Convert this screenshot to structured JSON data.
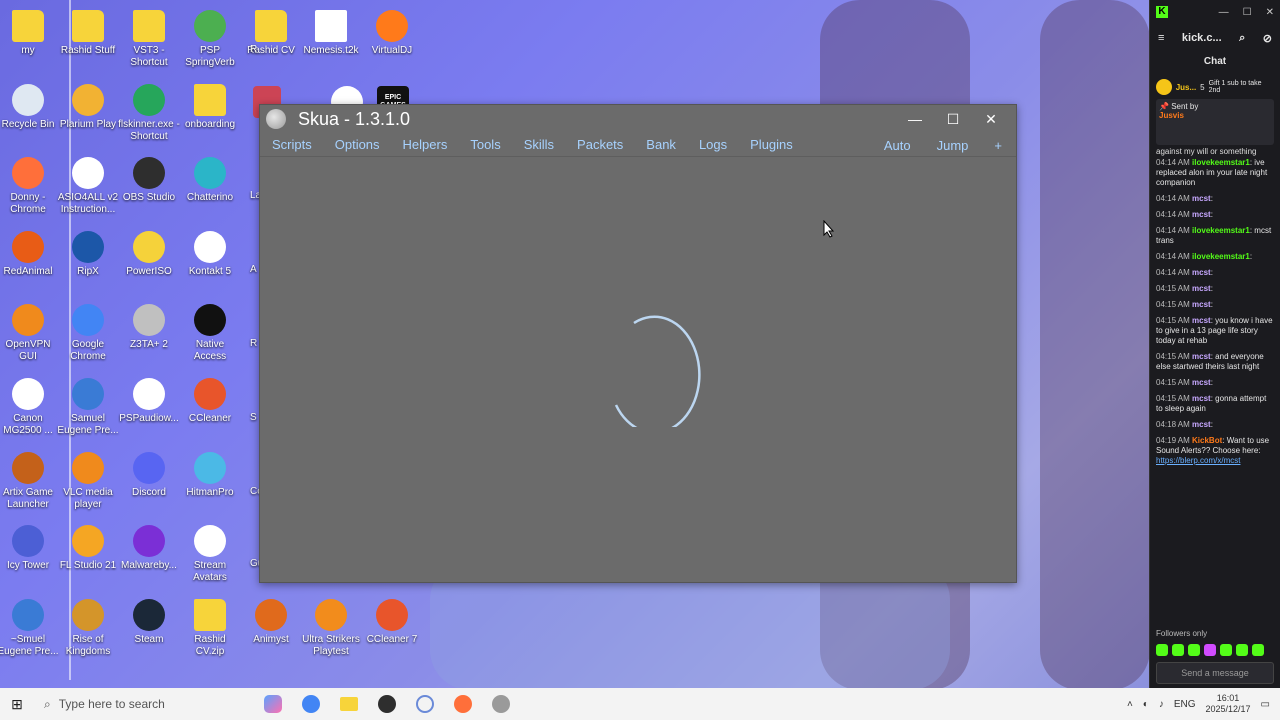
{
  "desktop": {
    "icons": [
      {
        "label": "my",
        "kind": "folder",
        "color": "#f7d43a"
      },
      {
        "label": "Rashid Stuff",
        "kind": "folder",
        "color": "#f7d43a"
      },
      {
        "label": "VST3 - Shortcut",
        "kind": "folder",
        "color": "#f7d43a"
      },
      {
        "label": "PSP SpringVerb",
        "kind": "app",
        "color": "#4caf50"
      },
      {
        "label": "Rashid CV",
        "kind": "folder",
        "color": "#f7d43a"
      },
      {
        "label": "Nemesis.t2k",
        "kind": "file",
        "color": "#ffffff"
      },
      {
        "label": "VirtualDJ",
        "kind": "app",
        "color": "#ff7a1a"
      },
      {
        "label": "Recycle Bin",
        "kind": "app",
        "color": "#dfe8f2"
      },
      {
        "label": "Plarium Play",
        "kind": "app",
        "color": "#f2b233"
      },
      {
        "label": "flskinner.exe - Shortcut",
        "kind": "app",
        "color": "#26a65b"
      },
      {
        "label": "onboarding",
        "kind": "folder",
        "color": "#f7d43a"
      },
      {
        "label": "Donny - Chrome",
        "kind": "app",
        "color": "#ff6f3a"
      },
      {
        "label": "ASIO4ALL v2 Instruction...",
        "kind": "app",
        "color": "#ffffff"
      },
      {
        "label": "OBS Studio",
        "kind": "app",
        "color": "#2e2e2e"
      },
      {
        "label": "Chatterino",
        "kind": "app",
        "color": "#2bb5c8"
      },
      {
        "label": "RedAnimal",
        "kind": "app",
        "color": "#e85c16"
      },
      {
        "label": "RipX",
        "kind": "app",
        "color": "#1c57a8"
      },
      {
        "label": "PowerISO",
        "kind": "app",
        "color": "#f5d23a"
      },
      {
        "label": "Kontakt 5",
        "kind": "app",
        "color": "#ffffff"
      },
      {
        "label": "OpenVPN GUI",
        "kind": "app",
        "color": "#f08a1c"
      },
      {
        "label": "Google Chrome",
        "kind": "app",
        "color": "#4285f4"
      },
      {
        "label": "Z3TA+ 2",
        "kind": "app",
        "color": "#c0c0c0"
      },
      {
        "label": "Native Access",
        "kind": "app",
        "color": "#111111"
      },
      {
        "label": "Canon MG2500 ...",
        "kind": "app",
        "color": "#ffffff"
      },
      {
        "label": "Samuel Eugene Pre...",
        "kind": "app",
        "color": "#3a7bd5"
      },
      {
        "label": "PSPaudiow...",
        "kind": "app",
        "color": "#ffffff"
      },
      {
        "label": "CCleaner",
        "kind": "app",
        "color": "#e8552b"
      },
      {
        "label": "Artix Game Launcher",
        "kind": "app",
        "color": "#c4611a"
      },
      {
        "label": "VLC media player",
        "kind": "app",
        "color": "#f08a1c"
      },
      {
        "label": "Discord",
        "kind": "app",
        "color": "#5865f2"
      },
      {
        "label": "HitmanPro",
        "kind": "app",
        "color": "#4bb9e6"
      },
      {
        "label": "Icy Tower",
        "kind": "app",
        "color": "#4c5fd5"
      },
      {
        "label": "FL Studio 21",
        "kind": "app",
        "color": "#f5a623"
      },
      {
        "label": "Malwareby...",
        "kind": "app",
        "color": "#7b2fd6"
      },
      {
        "label": "Stream Avatars",
        "kind": "app",
        "color": "#ffffff"
      },
      {
        "label": "~Smuel Eugene Pre...",
        "kind": "app",
        "color": "#3a7bd5"
      },
      {
        "label": "Rise of Kingdoms",
        "kind": "app",
        "color": "#d4952a"
      },
      {
        "label": "Steam",
        "kind": "app",
        "color": "#1b2838"
      },
      {
        "label": "Rashid CV.zip",
        "kind": "folder",
        "color": "#f7d43a"
      },
      {
        "label": "Animyst",
        "kind": "app",
        "color": "#e06a1c"
      },
      {
        "label": "Ultra Strikers Playtest",
        "kind": "app",
        "color": "#f28c1c"
      },
      {
        "label": "CCleaner 7",
        "kind": "app",
        "color": "#e8552b"
      }
    ],
    "partial_icon_labels": [
      "R",
      "La",
      "A",
      "R",
      "S",
      "Co",
      "Gu"
    ],
    "behind_window_icon_label": "EPIC GAMES"
  },
  "skua": {
    "title": "Skua - 1.3.1.0",
    "menu": [
      "Scripts",
      "Options",
      "Helpers",
      "Tools",
      "Skills",
      "Packets",
      "Bank",
      "Logs",
      "Plugins"
    ],
    "menu_right": [
      "Auto",
      "Jump",
      "+"
    ],
    "window_controls": {
      "minimize": "—",
      "maximize": "☐",
      "close": "✕"
    },
    "loading": true
  },
  "chat": {
    "url": "kick.c...",
    "heading": "Chat",
    "gift": {
      "user": "Jus...",
      "count": "5",
      "text": "Gift 1 sub to take 2nd"
    },
    "pinned_label": "Sent by",
    "pinned_user": "Jusvis",
    "pinned_text": "against my will or something",
    "messages": [
      {
        "time": "04:14 AM",
        "user": "ilovekeemstar1",
        "text": ": ive replaced alon im your late night companion"
      },
      {
        "time": "04:14 AM",
        "user": "mcst",
        "text": ":"
      },
      {
        "time": "04:14 AM",
        "user": "mcst",
        "text": ":"
      },
      {
        "time": "04:14 AM",
        "user": "ilovekeemstar1",
        "text": ": mcst trans"
      },
      {
        "time": "04:14 AM",
        "user": "ilovekeemstar1",
        "text": ":"
      },
      {
        "time": "04:14 AM",
        "user": "mcst",
        "text": ":"
      },
      {
        "time": "04:15 AM",
        "user": "mcst",
        "text": ":"
      },
      {
        "time": "04:15 AM",
        "user": "mcst",
        "text": ":"
      },
      {
        "time": "04:15 AM",
        "user": "mcst",
        "text": ": you know i have to give in a 13 page life story today at rehab"
      },
      {
        "time": "04:15 AM",
        "user": "mcst",
        "text": ": and everyone else startwed theirs last night"
      },
      {
        "time": "04:15 AM",
        "user": "mcst",
        "text": ":"
      },
      {
        "time": "04:15 AM",
        "user": "mcst",
        "text": ": gonna attempt to sleep again"
      },
      {
        "time": "04:18 AM",
        "user": "mcst",
        "text": ":"
      },
      {
        "time": "04:19 AM",
        "user": "KickBot",
        "text": ": Want to use Sound Alerts?? Choose here:"
      }
    ],
    "bot_link": "https://blerp.com/x/mcst",
    "followers_only": "Followers only",
    "send_placeholder": "Send a message"
  },
  "taskbar": {
    "search_placeholder": "Type here to search",
    "lang": "ENG",
    "time": "16:01",
    "date": "2025/12/17"
  },
  "colors": {
    "skua_bg": "#6b6b6b",
    "skua_menu": "#a7d2ff",
    "kick_green": "#53fc18",
    "chat_bg": "#1b1b1f"
  }
}
